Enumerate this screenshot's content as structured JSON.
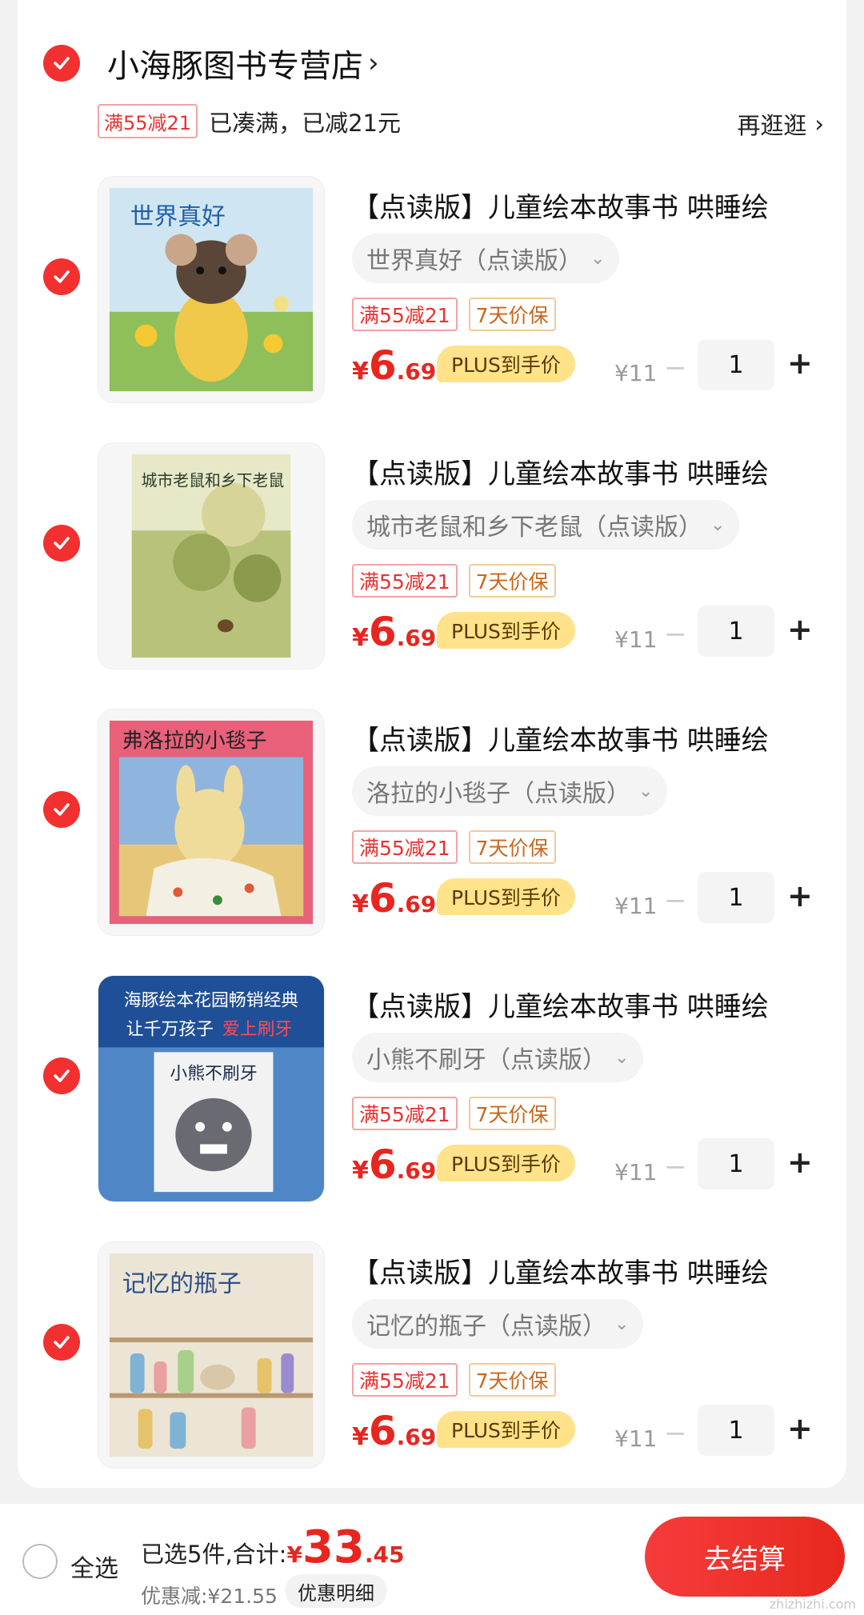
{
  "shop": {
    "name": "小海豚图书专营店",
    "chevron": "›",
    "promo_tag": "满55减21",
    "promo_text": "已凑满，已减21元",
    "more": "再逛逛",
    "more_chevron": "›"
  },
  "items": [
    {
      "title": "【点读版】儿童绘本故事书 哄睡绘",
      "variant": "世界真好（点读版）",
      "tag_discount": "满55减21",
      "tag_guarantee": "7天价保",
      "price_symbol": "¥",
      "price_int": "6",
      "price_dec": ".69",
      "plus_badge": "PLUS到手价",
      "old_price": "¥11",
      "quantity": "1",
      "cover_text": "世界真好"
    },
    {
      "title": "【点读版】儿童绘本故事书 哄睡绘",
      "variant": "城市老鼠和乡下老鼠（点读版）",
      "tag_discount": "满55减21",
      "tag_guarantee": "7天价保",
      "price_symbol": "¥",
      "price_int": "6",
      "price_dec": ".69",
      "plus_badge": "PLUS到手价",
      "old_price": "¥11",
      "quantity": "1",
      "cover_text": "城市老鼠和乡下老鼠"
    },
    {
      "title": "【点读版】儿童绘本故事书 哄睡绘",
      "variant": "洛拉的小毯子（点读版）",
      "tag_discount": "满55减21",
      "tag_guarantee": "7天价保",
      "price_symbol": "¥",
      "price_int": "6",
      "price_dec": ".69",
      "plus_badge": "PLUS到手价",
      "old_price": "¥11",
      "quantity": "1",
      "cover_text": "弗洛拉的小毯子"
    },
    {
      "title": "【点读版】儿童绘本故事书 哄睡绘",
      "variant": "小熊不刷牙（点读版）",
      "tag_discount": "满55减21",
      "tag_guarantee": "7天价保",
      "price_symbol": "¥",
      "price_int": "6",
      "price_dec": ".69",
      "plus_badge": "PLUS到手价",
      "old_price": "¥11",
      "quantity": "1",
      "cover_text": "小熊不刷牙",
      "banner_line1": "海豚绘本花园畅销经典",
      "banner_line2": "让千万孩子",
      "banner_line2_highlight": "爱上刷牙"
    },
    {
      "title": "【点读版】儿童绘本故事书 哄睡绘",
      "variant": "记忆的瓶子（点读版）",
      "tag_discount": "满55减21",
      "tag_guarantee": "7天价保",
      "price_symbol": "¥",
      "price_int": "6",
      "price_dec": ".69",
      "plus_badge": "PLUS到手价",
      "old_price": "¥11",
      "quantity": "1",
      "cover_text": "记忆的瓶子"
    }
  ],
  "footer": {
    "select_all": "全选",
    "selected": "已选5件,合计:",
    "total_symbol": "¥",
    "total_int": "33",
    "total_dec": ".45",
    "discount": "优惠减:¥21.55",
    "detail": "优惠明细",
    "checkout": "去结算"
  },
  "watermark": "zhizhizhi.com",
  "colors": {
    "accent_red": "#e8251f",
    "check_red": "#f23030",
    "plus_gold": "#ffe28a"
  }
}
